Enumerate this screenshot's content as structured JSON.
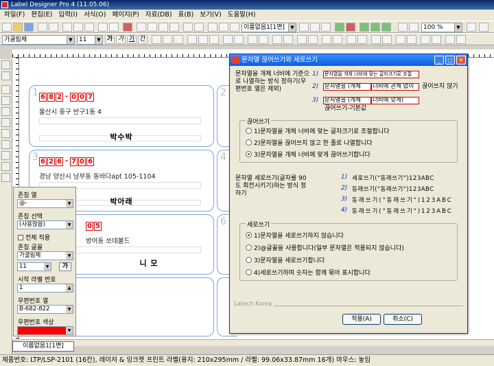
{
  "window": {
    "title": "Label Designer Pro 4 (11.05.06)"
  },
  "menu": [
    "파일(F)",
    "편집(E)",
    "입력(I)",
    "서식(O)",
    "페이지(P)",
    "자료(DB)",
    "표(B)",
    "보기(V)",
    "도움말(H)"
  ],
  "toolbar": {
    "page_select": "이름없음1[1면]",
    "zoom": "100 %",
    "font": "가굴림체",
    "font_size": "11",
    "style_glyphs": [
      "가",
      "가",
      "가",
      "간"
    ]
  },
  "labels": [
    {
      "num": "1",
      "zip": [
        "6",
        "8",
        "2",
        "-",
        "0",
        "0",
        "7"
      ],
      "address": "울산시 중구 반구1동 4",
      "name": "박수박"
    },
    {
      "num": "3",
      "zip": [
        "6",
        "2",
        "6",
        "-",
        "7",
        "0",
        "6"
      ],
      "address": "경남 양산시 남부동 동바다apt 105-1104",
      "name": "박아래"
    },
    {
      "num": "5",
      "zip": [
        "0",
        "5"
      ],
      "address": "방어동 쏘데볼드",
      "name": "니 모"
    },
    {
      "num": "2"
    },
    {
      "num": "4"
    },
    {
      "num": "6"
    }
  ],
  "sheet_tab": "이름없음1[1면]",
  "status_bar": "제품번호: LTP/LSP-2101 (16칸), 레이저 & 잉크젯 프린트 라벨(용지: 210x295mm / 라벨: 99.06x33.87mm 16개) 마우스: 놓임",
  "props": {
    "col_label": "존칭 열",
    "col_value": "@-",
    "sel_label": "존칭 선택",
    "sel_value": "(사용않음)",
    "apply_all": "전체 적용",
    "font_label": "존칭 글꼴",
    "font_value": "가굴림체",
    "size_value": "11",
    "bold_glyph": "가",
    "start_label": "시작 라벨 번호",
    "start_value": "1",
    "zipcol_label": "우편번호 열",
    "zipcol_value": "B-682-822",
    "zipcolor_label": "우편번호 색상",
    "zipcolor_hex": "#ff0000"
  },
  "dialog": {
    "title": "문자열 끊어쓰기와 세로쓰기",
    "desc1": "문자열을 개체 너비에 기준으로 나열하는 방식 정하기(우편번호 열은 제외)",
    "ex1_num": "1)",
    "ex1_text": "문자열을 개체 너비에 맞는 글자크기로 조절",
    "ex2_num": "2)",
    "ex2_a": "문자열을 (개체",
    "ex2_b": "너비에 관계 없이",
    "ex2_c": "끊어쓰지 않기",
    "ex3_num": "3)",
    "ex3_a": "문자열을 (개체",
    "ex3_b": "너비에 맞게)",
    "ex3_c": "끊어쓰기-기본값",
    "group1_title": "끊어쓰기",
    "opt1": "1)문자열을 개체 너비에 맞는 글자크기로 조절합니다",
    "opt2": "2)문자열을 끊어쓰지 않고 한 줄로 나열합니다",
    "opt3": "3)문자열을 개체 너비에 맞게 끊어쓰기합니다",
    "desc2": "문자열 세로쓰기(글자를 90도 회전시키기)하는 방식 정하기",
    "v1_num": "1)",
    "v1_text": "세로쓰기(\"동래쓰기\")123ABC",
    "v2_num": "2)",
    "v2_text": "동래쓰기(\"동래쓰기\")123ABC",
    "v3_num": "3)",
    "v3_text": "동래쓰기(\"동래쓰기\")123ABC",
    "v4_num": "4)",
    "v4_text": "동래쓰기(\"동래쓰기\")123ABC",
    "group2_title": "세로쓰기",
    "vopt1": "1)문자열을 세로쓰기하지 않습니다",
    "vopt2": "2)@글꼴을 사용합니다(일부 문자열은 적용되지 않습니다)",
    "vopt3": "3)문자열을 세로쓰기합니다",
    "vopt4": "4)세로쓰기하며 숫자는 함께 묶어 표시합니다",
    "footer_brand": "Latech Korea",
    "ok_label": "적용(A)",
    "cancel_label": "취소(C)"
  }
}
